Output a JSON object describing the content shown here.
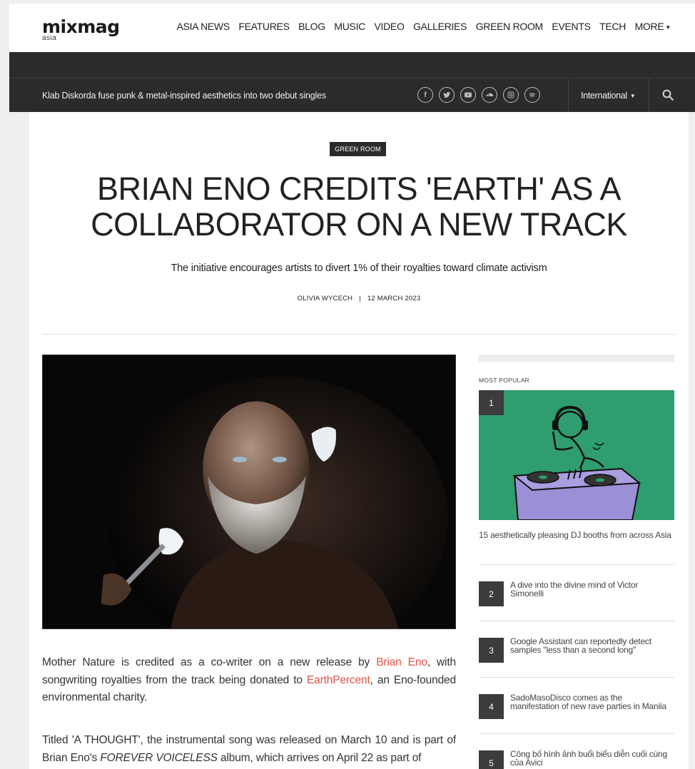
{
  "header": {
    "logo_main": "mixmag",
    "logo_sub": "asia",
    "nav": [
      "ASIA NEWS",
      "FEATURES",
      "BLOG",
      "MUSIC",
      "VIDEO",
      "GALLERIES",
      "GREEN ROOM",
      "EVENTS",
      "TECH"
    ],
    "more_label": "MORE"
  },
  "ticker": {
    "text": "Klab Diskorda fuse punk & metal-inspired aesthetics into two debut singles"
  },
  "socials": [
    "facebook-icon",
    "twitter-icon",
    "youtube-icon",
    "soundcloud-icon",
    "instagram-icon",
    "spotify-icon"
  ],
  "region": {
    "label": "International"
  },
  "article": {
    "category": "GREEN ROOM",
    "headline_line1": "BRIAN ENO CREDITS 'EARTH' AS A",
    "headline_line2": "COLLABORATOR ON A NEW TRACK",
    "subhead": "The initiative encourages artists to divert 1% of their royalties toward climate activism",
    "author": "OLIVIA WYCECH",
    "date": "12 MARCH 2023",
    "p1_a": "Mother Nature is credited as a co-writer on a new release by ",
    "p1_link1": "Brian Eno",
    "p1_b": ", with songwriting royalties from the track being donated to ",
    "p1_link2": "EarthPercent",
    "p1_c": ", an Eno-founded environmental charity.",
    "p2_a": "Titled 'A THOUGHT', the instrumental song was released on March 10 and is part of Brian Eno's ",
    "p2_em": "FOREVER VOICELESS",
    "p2_b": " album, which arrives on April 22 as part of"
  },
  "sidebar": {
    "heading": "MOST POPULAR",
    "featured": {
      "num": "1",
      "title": "15 aesthetically pleasing DJ booths from across Asia"
    },
    "items": [
      {
        "num": "2",
        "title": "A dive into the divine mind of Victor Simonelli"
      },
      {
        "num": "3",
        "title": "Google Assistant can reportedly detect samples \"less than a second long\""
      },
      {
        "num": "4",
        "title": "SadoMasoDisco comes as the manifestation of new rave parties in Manila"
      },
      {
        "num": "5",
        "title": "Công bố hình ảnh buổi biểu diễn cuối cùng của Avici"
      }
    ]
  },
  "colors": {
    "link": "#e2524a",
    "dark_band": "#2b2b2b",
    "featured_bg": "#2f9d6e"
  }
}
